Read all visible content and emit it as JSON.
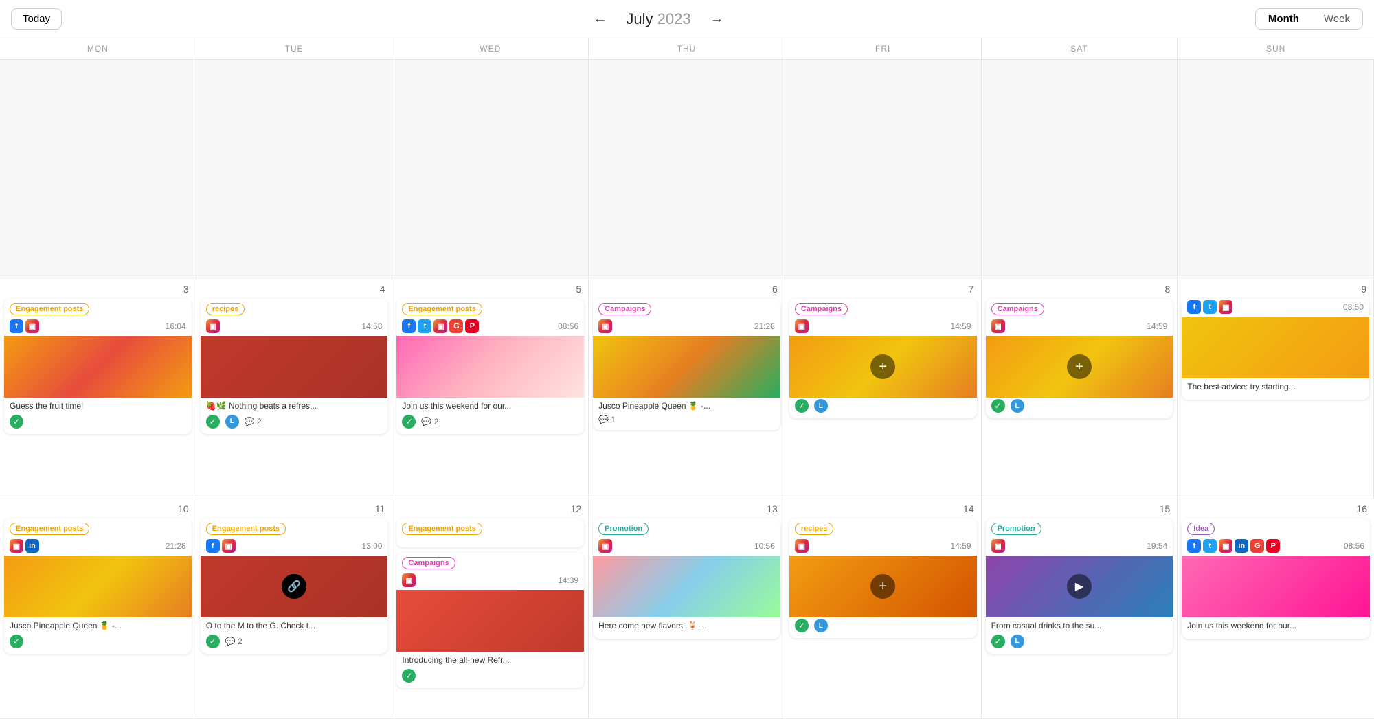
{
  "header": {
    "today_label": "Today",
    "prev_arrow": "←",
    "next_arrow": "→",
    "month": "July",
    "year": "2023",
    "view_month": "Month",
    "view_week": "Week"
  },
  "days": [
    "MON",
    "TUE",
    "WED",
    "THU",
    "FRI",
    "SAT",
    "SUN"
  ],
  "weeks": [
    {
      "cells": [
        {
          "num": "",
          "gray": true,
          "cards": []
        },
        {
          "num": "",
          "gray": true,
          "cards": []
        },
        {
          "num": "",
          "gray": true,
          "cards": []
        },
        {
          "num": "",
          "gray": true,
          "cards": []
        },
        {
          "num": "",
          "gray": true,
          "cards": []
        },
        {
          "num": "",
          "gray": true,
          "cards": []
        },
        {
          "num": "",
          "gray": true,
          "cards": []
        }
      ]
    },
    {
      "cells": [
        {
          "num": "3",
          "gray": false,
          "cards": [
            {
              "badge": "Engagement posts",
              "badge_class": "badge-orange",
              "socials": [
                "fb",
                "ig"
              ],
              "time": "16:04",
              "img_class": "img-fruit-orange",
              "text": "Guess the fruit time!",
              "check": true,
              "avatar": false,
              "comments": 0,
              "link": false,
              "play": false,
              "plus": false
            }
          ]
        },
        {
          "num": "4",
          "gray": false,
          "cards": [
            {
              "badge": "recipes",
              "badge_class": "badge-orange",
              "socials": [
                "ig"
              ],
              "time": "14:58",
              "img_class": "img-drinks-red",
              "text": "🍓🌿 Nothing beats a refres...",
              "check": true,
              "avatar": true,
              "comments": 2,
              "link": false,
              "play": false,
              "plus": false
            }
          ]
        },
        {
          "num": "5",
          "gray": false,
          "cards": [
            {
              "badge": "Engagement posts",
              "badge_class": "badge-orange",
              "socials": [
                "fb",
                "tw",
                "ig",
                "gg",
                "pi"
              ],
              "time": "08:56",
              "img_class": "img-pink-drink",
              "text": "Join us this weekend for our...",
              "check": true,
              "avatar": false,
              "comments": 2,
              "link": false,
              "play": false,
              "plus": false
            }
          ]
        },
        {
          "num": "6",
          "gray": false,
          "cards": [
            {
              "badge": "Campaigns",
              "badge_class": "badge-pink",
              "socials": [
                "ig"
              ],
              "time": "21:28",
              "img_class": "img-pineapple",
              "text": "Jusco Pineapple Queen 🍍 -...",
              "check": false,
              "avatar": false,
              "comments": 1,
              "link": false,
              "play": false,
              "plus": false
            }
          ]
        },
        {
          "num": "7",
          "gray": false,
          "cards": [
            {
              "badge": "Campaigns",
              "badge_class": "badge-pink",
              "socials": [
                "ig"
              ],
              "time": "14:59",
              "img_class": "img-citrus",
              "text": "",
              "check": true,
              "avatar": true,
              "comments": 0,
              "link": false,
              "play": false,
              "plus": true
            }
          ]
        },
        {
          "num": "8",
          "gray": false,
          "cards": [
            {
              "badge": "Campaigns",
              "badge_class": "badge-pink",
              "socials": [
                "ig"
              ],
              "time": "14:59",
              "img_class": "img-citrus",
              "text": "",
              "check": true,
              "avatar": true,
              "comments": 0,
              "link": false,
              "play": false,
              "plus": true
            }
          ]
        },
        {
          "num": "9",
          "gray": false,
          "cards": [
            {
              "badge": "",
              "badge_class": "",
              "socials": [
                "fb",
                "tw",
                "ig"
              ],
              "time": "08:50",
              "img_class": "img-lemon",
              "text": "The best advice: try starting...",
              "check": false,
              "avatar": false,
              "comments": 0,
              "link": false,
              "play": false,
              "plus": false
            }
          ]
        }
      ]
    },
    {
      "cells": [
        {
          "num": "10",
          "gray": false,
          "cards": [
            {
              "badge": "Engagement posts",
              "badge_class": "badge-orange",
              "socials": [
                "ig",
                "li"
              ],
              "time": "21:28",
              "img_class": "img-citrus",
              "text": "Jusco Pineapple Queen 🍍 -...",
              "check": true,
              "avatar": false,
              "comments": 0,
              "link": false,
              "play": false,
              "plus": false
            }
          ]
        },
        {
          "num": "11",
          "gray": false,
          "cards": [
            {
              "badge": "Engagement posts",
              "badge_class": "badge-orange",
              "socials": [
                "fb",
                "ig"
              ],
              "time": "13:00",
              "img_class": "img-drinks-red",
              "text": "O to the M to the G. Check t...",
              "check": true,
              "avatar": false,
              "comments": 2,
              "link": true,
              "play": false,
              "plus": false
            }
          ]
        },
        {
          "num": "12",
          "gray": false,
          "cards": [
            {
              "badge": "Engagement posts",
              "badge_class": "badge-orange",
              "socials": [],
              "time": "",
              "img_class": "",
              "text": "",
              "check": false,
              "avatar": false,
              "comments": 0,
              "link": false,
              "play": false,
              "plus": false
            },
            {
              "badge": "Campaigns",
              "badge_class": "badge-pink",
              "socials": [
                "ig"
              ],
              "time": "14:39",
              "img_class": "img-smoothie",
              "text": "Introducing the all-new Refr...",
              "check": true,
              "avatar": false,
              "comments": 0,
              "link": false,
              "play": false,
              "plus": false
            }
          ]
        },
        {
          "num": "13",
          "gray": false,
          "cards": [
            {
              "badge": "Promotion",
              "badge_class": "badge-teal",
              "socials": [
                "ig"
              ],
              "time": "10:56",
              "img_class": "img-peach",
              "text": "Here come new flavors! 🍹 ...",
              "check": false,
              "avatar": false,
              "comments": 0,
              "link": false,
              "play": false,
              "plus": false
            }
          ]
        },
        {
          "num": "14",
          "gray": false,
          "cards": [
            {
              "badge": "recipes",
              "badge_class": "badge-orange",
              "socials": [
                "ig"
              ],
              "time": "14:59",
              "img_class": "img-orange-drink",
              "text": "",
              "check": true,
              "avatar": true,
              "comments": 0,
              "link": false,
              "play": false,
              "plus": true
            }
          ]
        },
        {
          "num": "15",
          "gray": false,
          "cards": [
            {
              "badge": "Promotion",
              "badge_class": "badge-teal",
              "socials": [
                "ig"
              ],
              "time": "19:54",
              "img_class": "img-iced-drink",
              "text": "From casual drinks to the su...",
              "check": true,
              "avatar": true,
              "comments": 0,
              "link": false,
              "play": true,
              "plus": false
            }
          ]
        },
        {
          "num": "16",
          "gray": false,
          "cards": [
            {
              "badge": "Idea",
              "badge_class": "badge-purple",
              "socials": [
                "fb",
                "tw",
                "ig",
                "li",
                "gg",
                "pi"
              ],
              "time": "08:56",
              "img_class": "img-strawberry",
              "text": "Join us this weekend for our...",
              "check": false,
              "avatar": false,
              "comments": 0,
              "link": false,
              "play": false,
              "plus": false
            }
          ]
        }
      ]
    }
  ]
}
